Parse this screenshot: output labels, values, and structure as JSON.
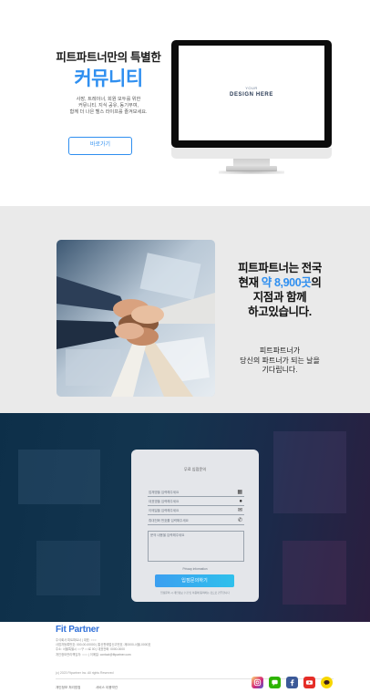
{
  "community": {
    "title": "피트파트너만의 특별한",
    "accent": "커뮤니티",
    "description": [
      "사장, 트레이너, 회원 모두를 위한",
      "커뮤니티. 지식 공유, 동기부여,",
      "함께 더 나은 헬스 라이프를 즐겨보세요."
    ],
    "button_label": "바로가기",
    "mockup_small": "YOUR",
    "mockup_text": "DESIGN HERE"
  },
  "partners": {
    "headline_1": "피트파트너는 전국",
    "headline_2_pre": "현재 ",
    "headline_2_em": "약 8,900곳",
    "headline_2_post": "의",
    "headline_3": "지점과 함께",
    "headline_4": "하고있습니다.",
    "sub_1": "피트파트너가",
    "sub_2": "당신의 파트너가 되는 날을",
    "sub_3": "기다립니다."
  },
  "consult": {
    "title": "무료 입점문의",
    "fields": [
      {
        "placeholder": "업체명을 입력해주세요",
        "icon": "building-icon"
      },
      {
        "placeholder": "대표명을 입력해주세요",
        "icon": "person-icon"
      },
      {
        "placeholder": "이메일을 입력해주세요",
        "icon": "mail-icon"
      },
      {
        "placeholder": "휴대전화 번호를 입력해주세요",
        "icon": "phone-icon"
      }
    ],
    "textarea_placeholder": "문의 내용을 입력해주세요",
    "privacy": "Privacy information",
    "submit_label": "입점문의하기",
    "fine_print": "입점문의 시 개인정보 수집 및 이용에 동의하는 것으로 간주합니다"
  },
  "footer": {
    "brand": "Fit Partner",
    "info": [
      "주식회사 피트파트너 | 대표: ○○○",
      "사업자등록번호: 000-00-00000 | 통신판매업신고번호: 제0000-서울-0000호",
      "주소: 서울특별시 ○○구 ○○로 00 | 대표전화: 0000-0000",
      "개인정보관리책임자: ○○○ | 이메일: contact@fitpartner.com"
    ],
    "copyright": "(c) 2023 Fitpartner Inc. All rights Reserved",
    "links": [
      "개인정보 처리방침",
      "서비스 이용약관"
    ],
    "social": [
      {
        "icon": "instagram-icon",
        "color": "#d6317f"
      },
      {
        "icon": "chat-icon",
        "color": "#2db400"
      },
      {
        "icon": "facebook-icon",
        "color": "#3b5998"
      },
      {
        "icon": "youtube-icon",
        "color": "#e52d27"
      },
      {
        "icon": "kakaotalk-icon",
        "color": "#f7d600"
      }
    ]
  },
  "colors": {
    "accent": "#2f8ff0",
    "section2_bg": "#eaeaea",
    "section3_bg": "#13354f",
    "brand": "#2f6fd8"
  }
}
